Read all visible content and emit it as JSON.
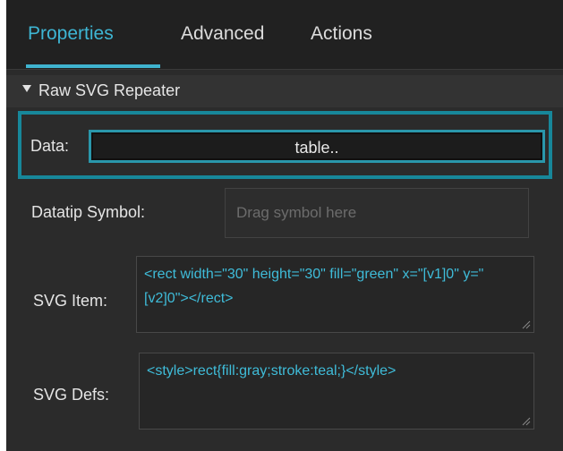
{
  "tabs": [
    {
      "label": "Properties",
      "active": true
    },
    {
      "label": "Advanced",
      "active": false
    },
    {
      "label": "Actions",
      "active": false
    }
  ],
  "section": {
    "title": "Raw SVG Repeater",
    "expanded": true
  },
  "fields": {
    "data": {
      "label": "Data:",
      "value": "table.."
    },
    "datatip_symbol": {
      "label": "Datatip Symbol:",
      "placeholder": "Drag symbol here"
    },
    "svg_item": {
      "label": "SVG Item:",
      "value": "<rect width=\"30\" height=\"30\" fill=\"green\" x=\"[v1]0\" y=\"[v2]0\"></rect>"
    },
    "svg_defs": {
      "label": "SVG Defs:",
      "value": "<style>rect{fill:gray;stroke:teal;}</style>"
    }
  },
  "colors": {
    "accent": "#3eb6d4",
    "highlight_border": "#17879a",
    "panel_bg": "#2b2b2b",
    "tabbar_bg": "#212121"
  }
}
